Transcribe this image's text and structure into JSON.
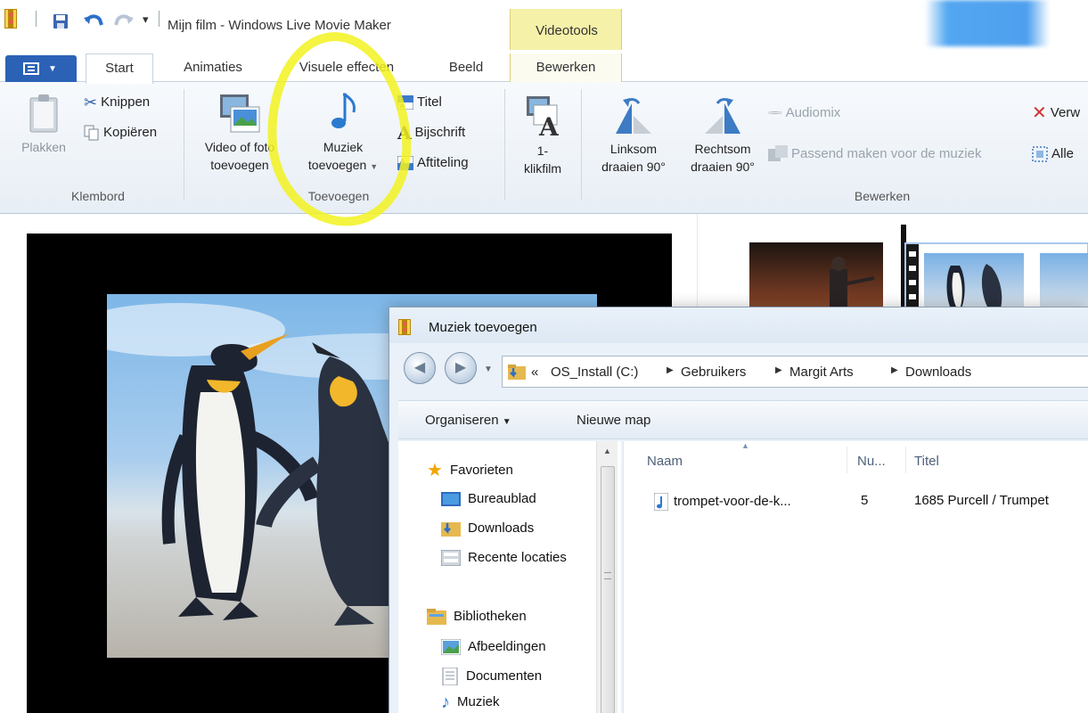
{
  "window": {
    "title": "Mijn film - Windows Live Movie Maker",
    "contextual_group": "Videotools"
  },
  "tabs": [
    {
      "label": "Start",
      "active": true
    },
    {
      "label": "Animaties"
    },
    {
      "label": "Visuele effecten"
    },
    {
      "label": "Beeld"
    },
    {
      "label": "Bewerken"
    }
  ],
  "ribbon": {
    "klembord": {
      "label": "Klembord",
      "paste": "Plakken",
      "cut": "Knippen",
      "copy": "Kopiëren"
    },
    "toevoegen": {
      "label": "Toevoegen",
      "video_line1": "Video of foto",
      "video_line2": "toevoegen",
      "music_line1": "Muziek",
      "music_line2": "toevoegen",
      "title": "Titel",
      "caption": "Bijschrift",
      "credits": "Aftiteling"
    },
    "autofilm": {
      "line1": "1-",
      "line2": "klikfilm"
    },
    "bewerken": {
      "label": "Bewerken",
      "rotate_left_line1": "Linksom",
      "rotate_left_line2": "draaien 90°",
      "rotate_right_line1": "Rechtsom",
      "rotate_right_line2": "draaien 90°",
      "audiomix": "Audiomix",
      "fit_music": "Passend maken voor de muziek",
      "remove": "Verw",
      "select_all": "Alle"
    }
  },
  "dialog": {
    "title": "Muziek toevoegen",
    "breadcrumb": [
      "OS_Install (C:)",
      "Gebruikers",
      "Margit Arts",
      "Downloads"
    ],
    "breadcrumb_overflow": "«",
    "commands": {
      "organize": "Organiseren",
      "new_folder": "Nieuwe map"
    },
    "nav": {
      "favorites": "Favorieten",
      "desktop": "Bureaublad",
      "downloads": "Downloads",
      "recent": "Recente locaties",
      "libraries": "Bibliotheken",
      "pictures": "Afbeeldingen",
      "documents": "Documenten",
      "music": "Muziek"
    },
    "columns": [
      "Naam",
      "Nu...",
      "Titel"
    ],
    "files": [
      {
        "name": "trompet-voor-de-k...",
        "number": "5",
        "title": "1685 Purcell / Trumpet"
      }
    ]
  }
}
